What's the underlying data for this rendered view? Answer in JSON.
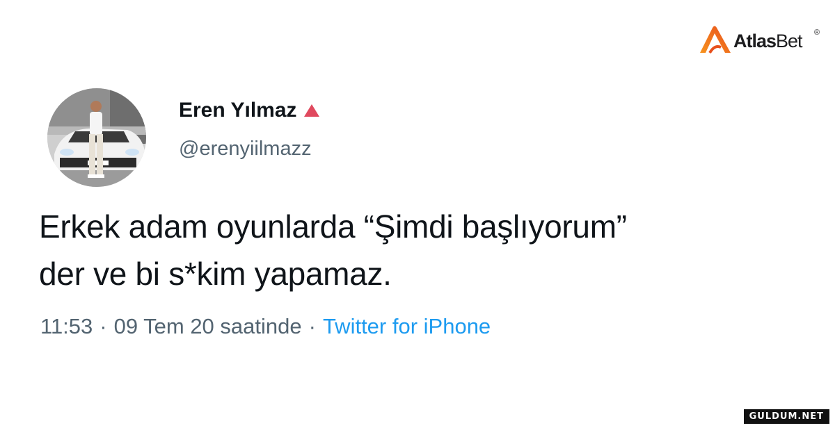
{
  "brand": {
    "name_bold": "Atlas",
    "name_regular": "Bet",
    "registered": "®",
    "accent": "#e8501c"
  },
  "author": {
    "display_name": "Eren Yılmaz",
    "handle": "@erenyiilmazz",
    "status_icon": "red-triangle-icon",
    "status_color": "#e0495e"
  },
  "tweet": {
    "lines": [
      "Erkek adam oyunlarda “Şimdi başlıyorum”",
      "der ve bi s*kim yapamaz."
    ]
  },
  "meta": {
    "time": "11:53",
    "separator": "·",
    "date": "09 Tem 20 saatinde",
    "source": "Twitter for iPhone",
    "source_color": "#1d9bf0"
  },
  "watermark": {
    "text": "GULDUM.NET"
  }
}
